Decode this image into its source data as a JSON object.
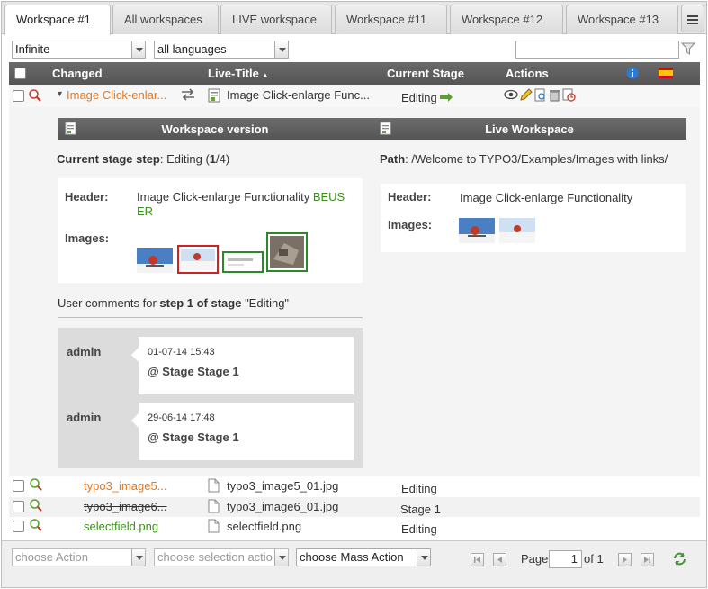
{
  "tabs": [
    {
      "label": "Workspace #1",
      "active": true
    },
    {
      "label": "All workspaces"
    },
    {
      "label": "LIVE workspace"
    },
    {
      "label": "Workspace #11"
    },
    {
      "label": "Workspace #12"
    },
    {
      "label": "Workspace #13"
    }
  ],
  "filters": {
    "depth": "Infinite",
    "language": "all languages",
    "search_value": ""
  },
  "grid": {
    "columns": {
      "changed": "Changed",
      "live_title": "Live-Title",
      "current_stage": "Current Stage",
      "actions": "Actions"
    }
  },
  "main_row": {
    "changed": "Image Click-enlar...",
    "live_title": "Image Click-enlarge Func...",
    "stage": "Editing"
  },
  "detail": {
    "ws_header": "Workspace version",
    "live_header": "Live Workspace",
    "stage_step_label": "Current stage step",
    "stage_step_prefix": ": Editing (",
    "stage_step_num": "1",
    "stage_step_sep": "/",
    "stage_step_total": "4",
    "stage_step_suffix": ")",
    "path_label": "Path",
    "path_value": ": /Welcome to TYPO3/Examples/Images with links/",
    "header_label": "Header:",
    "images_label": "Images:",
    "ws_header_value": "Image Click-enlarge Functionality",
    "ws_header_added": "BEUS",
    "ws_header_added2": "ER",
    "live_header_value": "Image Click-enlarge Functionality",
    "comments_prefix": "User comments for ",
    "comments_step": "step 1 of stage",
    "comments_stage": " \"Editing\"",
    "comments": [
      {
        "user": "admin",
        "date": "01-07-14 15:43",
        "text": "@ Stage Stage 1"
      },
      {
        "user": "admin",
        "date": "29-06-14 17:48",
        "text": "@ Stage Stage 1"
      }
    ]
  },
  "rows": [
    {
      "changed": "typo3_image5...",
      "live_title": "typo3_image5_01.jpg",
      "stage": "Editing",
      "style": "orange"
    },
    {
      "changed": "typo3_image6...",
      "live_title": "typo3_image6_01.jpg",
      "stage": "Stage 1",
      "style": "strike"
    },
    {
      "changed": "selectfield.png",
      "live_title": "selectfield.png",
      "stage": "Editing",
      "style": "green"
    }
  ],
  "toolbar": {
    "choose_action": "choose Action",
    "choose_selection": "choose selection action",
    "choose_mass": "choose Mass Action",
    "page_label": "Page",
    "page_value": "1",
    "of_label": "of 1"
  },
  "colors": {
    "changed_orange": "#e8771f",
    "new_green": "#3f8f1e",
    "header_grey": "#5f5f5f"
  }
}
